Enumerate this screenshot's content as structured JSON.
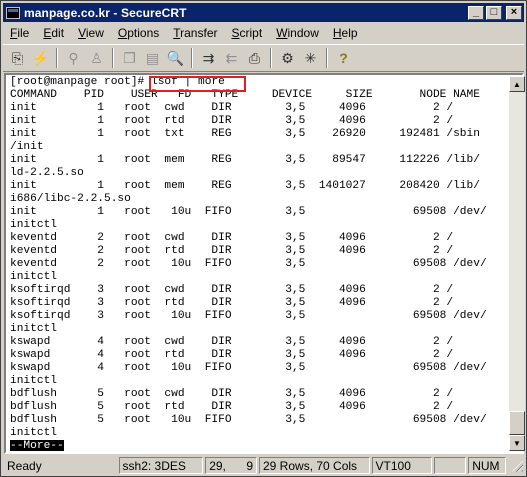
{
  "window": {
    "title": "manpage.co.kr - SecureCRT",
    "minimize": "_",
    "maximize": "□",
    "close": "×"
  },
  "menu": [
    {
      "first": "F",
      "rest": "ile"
    },
    {
      "first": "E",
      "rest": "dit"
    },
    {
      "first": "V",
      "rest": "iew"
    },
    {
      "first": "O",
      "rest": "ptions"
    },
    {
      "first": "T",
      "rest": "ransfer"
    },
    {
      "first": "S",
      "rest": "cript"
    },
    {
      "first": "W",
      "rest": "indow"
    },
    {
      "first": "H",
      "rest": "elp"
    }
  ],
  "toolbar": {
    "connect_icon": "⎘",
    "quick_connect_icon": "⚡",
    "disconnect_icon": "⚲",
    "reconnect_icon": "♙",
    "copy_icon": "❐",
    "paste_icon": "▤",
    "find_icon": "🔍",
    "send_file_icon": "⇉",
    "receive_file_icon": "⇇",
    "print_icon": "⎙",
    "session_options_icon": "⚙",
    "global_options_icon": "✳",
    "help_icon": "?"
  },
  "terminal": {
    "lines": [
      "[root@manpage root]# lsof | more",
      "COMMAND    PID    USER   FD   TYPE     DEVICE     SIZE       NODE NAME",
      "init         1   root  cwd    DIR        3,5     4096          2 /",
      "init         1   root  rtd    DIR        3,5     4096          2 /",
      "init         1   root  txt    REG        3,5    26920     192481 /sbin",
      "/init",
      "init         1   root  mem    REG        3,5    89547     112226 /lib/",
      "ld-2.2.5.so",
      "init         1   root  mem    REG        3,5  1401027     208420 /lib/",
      "i686/libc-2.2.5.so",
      "init         1   root   10u  FIFO        3,5                69508 /dev/",
      "initctl",
      "keventd      2   root  cwd    DIR        3,5     4096          2 /",
      "keventd      2   root  rtd    DIR        3,5     4096          2 /",
      "keventd      2   root   10u  FIFO        3,5                69508 /dev/",
      "initctl",
      "ksoftirqd    3   root  cwd    DIR        3,5     4096          2 /",
      "ksoftirqd    3   root  rtd    DIR        3,5     4096          2 /",
      "ksoftirqd    3   root   10u  FIFO        3,5                69508 /dev/",
      "initctl",
      "kswapd       4   root  cwd    DIR        3,5     4096          2 /",
      "kswapd       4   root  rtd    DIR        3,5     4096          2 /",
      "kswapd       4   root   10u  FIFO        3,5                69508 /dev/",
      "initctl",
      "bdflush      5   root  cwd    DIR        3,5     4096          2 /",
      "bdflush      5   root  rtd    DIR        3,5     4096          2 /",
      "bdflush      5   root   10u  FIFO        3,5                69508 /dev/",
      "initctl"
    ],
    "pager_prompt": "--More--",
    "highlight_color": "#e02020"
  },
  "statusbar": {
    "state": "Ready",
    "protocol": "ssh2: 3DES",
    "row": "29,",
    "col": "9",
    "size": "29 Rows,  70 Cols",
    "emulation": "VT100",
    "caps": "",
    "num": "NUM"
  }
}
